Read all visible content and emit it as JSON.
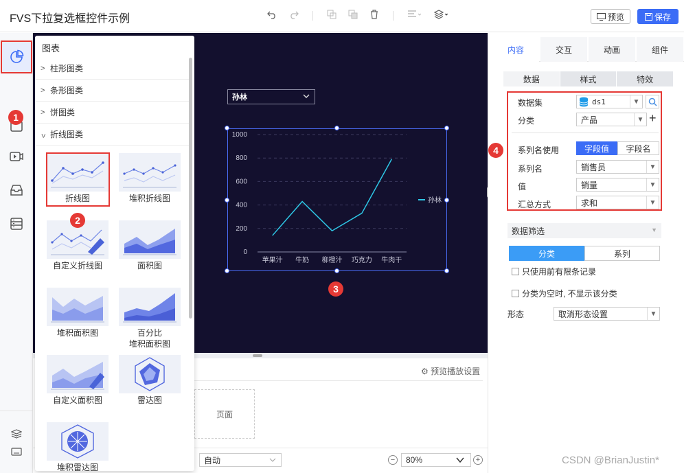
{
  "header": {
    "title": "FVS下拉复选框控件示例",
    "preview_label": "预览",
    "save_label": "保存"
  },
  "gallery": {
    "title": "图表",
    "categories": [
      {
        "label": "柱形图类",
        "chevron": ">"
      },
      {
        "label": "条形图类",
        "chevron": ">"
      },
      {
        "label": "饼图类",
        "chevron": ">"
      },
      {
        "label": "折线图类",
        "chevron": "<"
      }
    ],
    "tiles": [
      {
        "label": "折线图",
        "icon": "line-chart-icon"
      },
      {
        "label": "堆积折线图",
        "icon": "stacked-line-chart-icon"
      },
      {
        "label": "自定义折线图",
        "icon": "custom-line-chart-icon"
      },
      {
        "label": "面积图",
        "icon": "area-chart-icon"
      },
      {
        "label": "堆积面积图",
        "icon": "stacked-area-chart-icon"
      },
      {
        "label": "百分比\n堆积面积图",
        "icon": "percent-stacked-area-icon"
      },
      {
        "label": "自定义面积图",
        "icon": "custom-area-chart-icon"
      },
      {
        "label": "雷达图",
        "icon": "radar-chart-icon"
      },
      {
        "label": "堆积雷达图",
        "icon": "stacked-radar-chart-icon"
      }
    ]
  },
  "badges": {
    "one": "1",
    "two": "2",
    "three": "3",
    "four": "4"
  },
  "canvas": {
    "dropdown_value": "孙林"
  },
  "chart_data": {
    "type": "line",
    "categories": [
      "苹果汁",
      "牛奶",
      "柳橙汁",
      "巧克力",
      "牛肉干"
    ],
    "series": [
      {
        "name": "孙林",
        "values": [
          140,
          430,
          180,
          330,
          790
        ]
      }
    ],
    "ylim": [
      0,
      1000
    ],
    "yticks": [
      0,
      200,
      400,
      600,
      800,
      1000
    ],
    "grid": true,
    "legend": "right",
    "line_color": "#2ec7e6"
  },
  "bottom": {
    "preview_settings": "预览播放设置",
    "page_label": "页面",
    "auto_value": "自动",
    "zoom_value": "80%"
  },
  "rpanel": {
    "tabs": [
      "内容",
      "交互",
      "动画",
      "组件"
    ],
    "subtabs": [
      "数据",
      "样式",
      "特效"
    ],
    "dataset_label": "数据集",
    "dataset_value": "ds1",
    "category_label": "分类",
    "category_value": "产品",
    "series_use_label": "系列名使用",
    "series_use_options": [
      "字段值",
      "字段名"
    ],
    "series_name_label": "系列名",
    "series_name_value": "销售员",
    "value_label": "值",
    "value_value": "销量",
    "agg_label": "汇总方式",
    "agg_value": "求和",
    "filter_label": "数据筛选",
    "filter_tabs": [
      "分类",
      "系列"
    ],
    "check1": "只使用前有限条记录",
    "check2": "分类为空时, 不显示该分类",
    "form_label": "形态",
    "form_value": "取消形态设置"
  },
  "watermark": "CSDN @BrianJustin*"
}
